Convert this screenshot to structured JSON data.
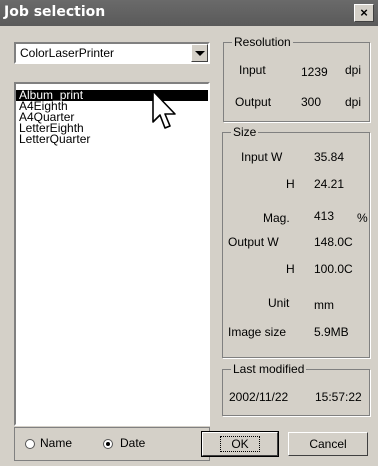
{
  "window": {
    "title": "Job selection",
    "close_glyph": "×"
  },
  "printer_select": {
    "value": "ColorLaserPrinter"
  },
  "job_list": {
    "items": [
      "Album_print",
      "A4Eighth",
      "A4Quarter",
      "LetterEighth",
      "LetterQuarter"
    ],
    "selected": "Album_print"
  },
  "resolution": {
    "legend": "Resolution",
    "input_label": "Input",
    "input_value": "1239",
    "input_unit": "dpi",
    "output_label": "Output",
    "output_value": "300",
    "output_unit": "dpi"
  },
  "size": {
    "legend": "Size",
    "input_w_label": "Input W",
    "input_w_value": "35.84",
    "input_h_label": "H",
    "input_h_value": "24.21",
    "mag_label": "Mag.",
    "mag_value": "413",
    "mag_unit": "%",
    "output_w_label": "Output W",
    "output_w_value": "148.0C",
    "output_h_label": "H",
    "output_h_value": "100.0C",
    "unit_label": "Unit",
    "unit_value": "mm",
    "image_size_label": "Image size",
    "image_size_value": "5.9MB"
  },
  "last_modified": {
    "legend": "Last modified",
    "date": "2002/11/22",
    "time": "15:57:22"
  },
  "sort": {
    "name_label": "Name",
    "date_label": "Date",
    "selected": "Date"
  },
  "buttons": {
    "ok": "OK",
    "cancel": "Cancel"
  },
  "icons": {
    "cursor": "arrow-pointer-icon"
  }
}
